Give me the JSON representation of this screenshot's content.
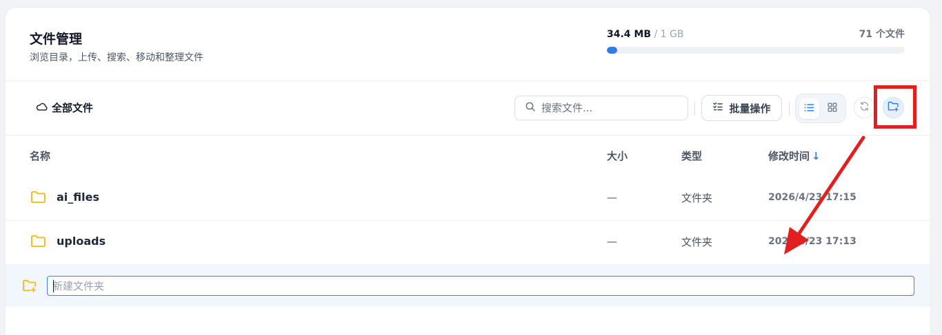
{
  "header": {
    "title": "文件管理",
    "subtitle": "浏览目录，上传、搜索、移动和整理文件"
  },
  "storage": {
    "used": "34.4 MB",
    "total_label": " / 1 GB",
    "file_count": "71 个文件",
    "usage_fraction": 0.0336
  },
  "toolbar": {
    "breadcrumb_label": "全部文件",
    "search_placeholder": "搜索文件...",
    "batch_label": "批量操作"
  },
  "table": {
    "columns": {
      "name": "名称",
      "size": "大小",
      "type": "类型",
      "modified": "修改时间",
      "sort_arrow": "↓"
    },
    "rows": [
      {
        "name": "ai_files",
        "size": "—",
        "type": "文件夹",
        "modified": "2026/4/23 17:15"
      },
      {
        "name": "uploads",
        "size": "—",
        "type": "文件夹",
        "modified": "2026/4/23 17:13"
      }
    ]
  },
  "new_folder": {
    "placeholder": "新建文件夹"
  },
  "colors": {
    "accent": "#2f7de9",
    "folder": "#f5b922",
    "annotation": "#e02020"
  },
  "icons": [
    "cloud-icon",
    "search-icon",
    "checklist-icon",
    "list-view-icon",
    "grid-view-icon",
    "refresh-icon",
    "folder-plus-icon",
    "folder-icon"
  ]
}
